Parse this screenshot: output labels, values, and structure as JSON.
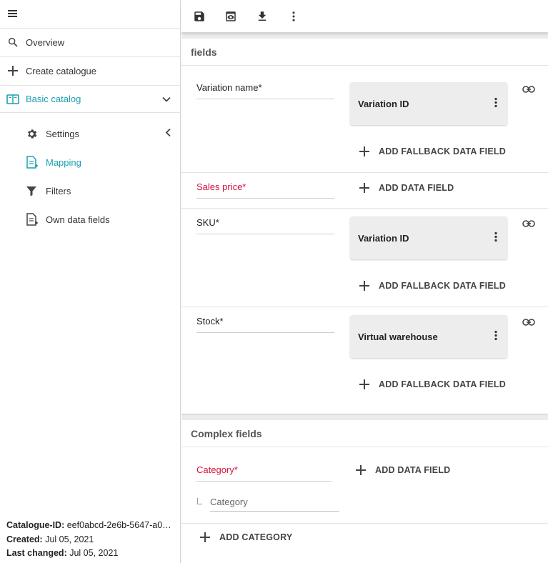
{
  "sidebar": {
    "items": [
      {
        "label": "Overview",
        "icon": "search-icon"
      },
      {
        "label": "Create catalogue",
        "icon": "plus-icon"
      },
      {
        "label": "Basic catalog",
        "icon": "book-icon"
      }
    ],
    "subitems": [
      {
        "label": "Settings",
        "icon": "gear-icon"
      },
      {
        "label": "Mapping",
        "icon": "document-icon"
      },
      {
        "label": "Filters",
        "icon": "funnel-icon"
      },
      {
        "label": "Own data fields",
        "icon": "document-add-icon"
      }
    ],
    "footer": {
      "id_label": "Catalogue-ID:",
      "id_value": "eef0abcd-2e6b-5647-a0…",
      "created_label": "Created:",
      "created_value": "Jul 05, 2021",
      "changed_label": "Last changed:",
      "changed_value": "Jul 05, 2021"
    }
  },
  "toolbar": {
    "icons": [
      "save-icon",
      "preview-icon",
      "download-icon",
      "more-vert-icon"
    ]
  },
  "fields_card": {
    "title": "fields",
    "rows": [
      {
        "label": "Variation name*",
        "chip": "Variation ID",
        "add_label": "ADD FALLBACK DATA FIELD"
      },
      {
        "label": "Sales price*",
        "add_label": "ADD DATA FIELD"
      },
      {
        "label": "SKU*",
        "chip": "Variation ID",
        "add_label": "ADD FALLBACK DATA FIELD"
      },
      {
        "label": "Stock*",
        "chip": "Virtual warehouse",
        "add_label": "ADD FALLBACK DATA FIELD"
      }
    ]
  },
  "complex_card": {
    "title": "Complex fields",
    "category_label": "Category*",
    "add_label": "ADD DATA FIELD",
    "sub_placeholder": "Category",
    "add_category_label": "ADD CATEGORY"
  },
  "colors": {
    "accent": "#1a9fb1",
    "required": "#d6113a"
  }
}
